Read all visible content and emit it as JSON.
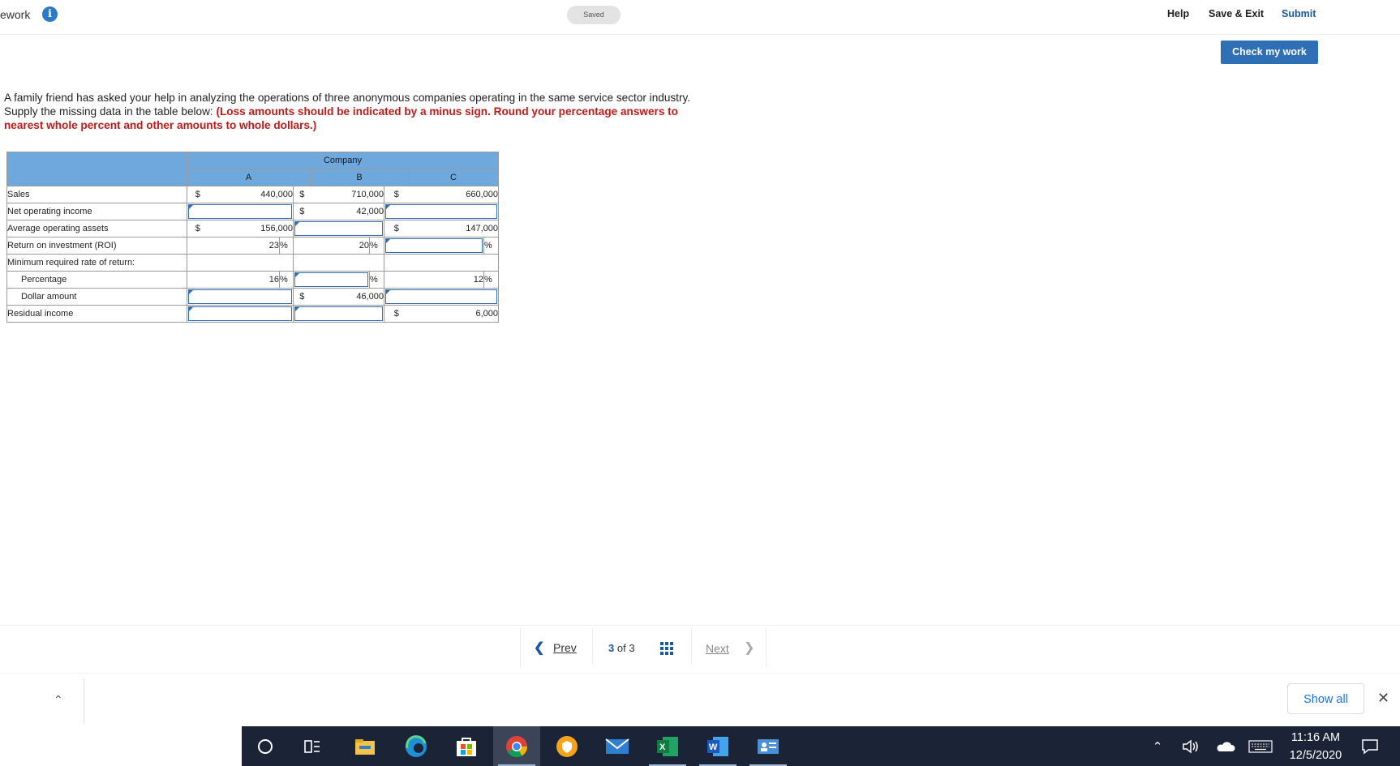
{
  "header": {
    "title": "ework",
    "saved": "Saved",
    "help": "Help",
    "save_exit": "Save & Exit",
    "submit": "Submit",
    "check_my_work": "Check my work"
  },
  "question": {
    "text": "A family friend has asked your help in analyzing the operations of three anonymous companies operating in the same service sector industry. Supply the missing data in the table below: ",
    "instruction": "(Loss amounts should be indicated by a minus sign. Round your percentage answers to nearest whole percent and other amounts to whole dollars.)"
  },
  "table": {
    "group_header": "Company",
    "columns": [
      "A",
      "B",
      "C"
    ],
    "currency": "$",
    "percent": "%",
    "rows": {
      "sales": "Sales",
      "noi": "Net operating income",
      "assets": "Average operating assets",
      "roi": "Return on investment (ROI)",
      "min_rate": "Minimum required rate of return:",
      "percentage": "Percentage",
      "dollar": "Dollar amount",
      "residual": "Residual income"
    },
    "values": {
      "a_sales": "440,000",
      "b_sales": "710,000",
      "c_sales": "660,000",
      "b_noi": "42,000",
      "a_assets": "156,000",
      "c_assets": "147,000",
      "a_roi": "23",
      "b_roi": "20",
      "a_pct": "16",
      "c_pct": "12",
      "b_dollar": "46,000",
      "c_residual": "6,000"
    }
  },
  "pager": {
    "prev": "Prev",
    "current": "3",
    "of": "of",
    "total": "3",
    "next": "Next"
  },
  "downloads": {
    "show_all": "Show all"
  },
  "taskbar": {
    "time": "11:16 AM",
    "date": "12/5/2020",
    "icons": [
      "start-search-icon",
      "task-view-icon",
      "file-explorer-icon",
      "edge-icon",
      "store-icon",
      "chrome-icon",
      "vpn-icon",
      "mail-icon",
      "excel-icon",
      "word-icon",
      "contacts-icon"
    ]
  }
}
